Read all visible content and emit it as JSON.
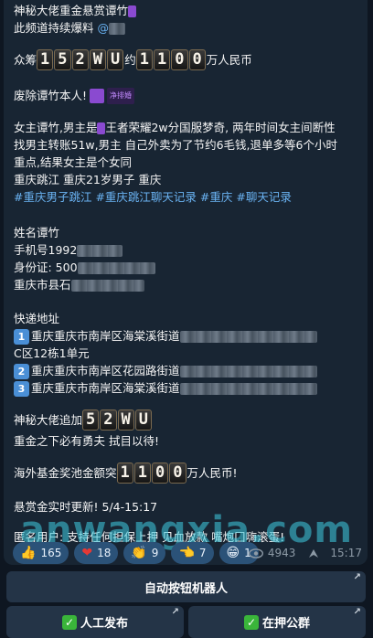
{
  "post": {
    "line1_text": "神秘大佬重金悬赏谭竹",
    "line2_text": "此频道持续爆料",
    "line2_handle": "@",
    "bounty_prefix": "众筹",
    "bounty_tiles_a": [
      "1",
      "5",
      "2",
      "W",
      "U"
    ],
    "bounty_mid": "约",
    "bounty_tiles_b": [
      "1",
      "1",
      "0",
      "0"
    ],
    "bounty_suffix": "万人民币",
    "line_abolish": "废除谭竹本人!",
    "sticker_label": "净排婚",
    "para1": "女主谭竹,男主是",
    "para1b": "王者荣耀2w分国服梦奇, 两年时间女主间断性",
    "para2": "找男主转账51w,男主 自己外卖为了节约6毛钱,退单多等6个小时",
    "para3": "重点,结果女主是个女同",
    "para4": "重庆跳江  重庆21岁男子 重庆",
    "tags": "#重庆男子跳江 #重庆跳江聊天记录 #重庆 #聊天记录",
    "name_line": "姓名谭竹",
    "phone_line": "手机号1992",
    "id_line": "身份证: 500",
    "addr_line": "重庆市县石",
    "delivery_title": "快递地址",
    "addr1": "重庆重庆市南岸区海棠溪街道",
    "addr1_cont": "C区12栋1单元",
    "addr2": "重庆重庆市南岸区花园路街道",
    "addr3": "重庆重庆市南岸区海棠溪街道",
    "num1": "1",
    "num2": "2",
    "num3": "3",
    "append_prefix": "神秘大佬追加",
    "append_tiles": [
      "5",
      "2",
      "W",
      "U"
    ],
    "brave_line": "重金之下必有勇夫 拭目以待!",
    "fund_prefix": "海外基金奖池金额突",
    "fund_tiles": [
      "1",
      "1",
      "0",
      "0"
    ],
    "fund_suffix": "万人民币!",
    "update_line": "悬赏金实时更新! 5/4-15:17",
    "anon_line": "匿名用户: 支持任何担保上押 见血放款 嘴炮囗嗨滚蛋!"
  },
  "watermark": "anwangxia.com",
  "reactions": [
    {
      "icon": "thumbs-up-icon",
      "emoji": "👍",
      "count": "165"
    },
    {
      "icon": "heart-icon",
      "emoji": "❤",
      "count": "18"
    },
    {
      "icon": "clapping-hands-icon",
      "emoji": "👏",
      "count": "9"
    },
    {
      "icon": "pointing-hand-icon",
      "emoji": "👈",
      "count": "7"
    },
    {
      "icon": "grinning-face-icon",
      "emoji": "😁",
      "count": "1"
    }
  ],
  "meta": {
    "views": "4943",
    "time": "15:17"
  },
  "buttons": {
    "bot": "自动按钮机器人",
    "publish": "人工发布",
    "escrow": "在押公群"
  },
  "colors": {
    "background": "#0e1621",
    "bubble": "#182533",
    "link": "#6ab3f3",
    "reaction": "#2b5278",
    "button": "#243447"
  }
}
